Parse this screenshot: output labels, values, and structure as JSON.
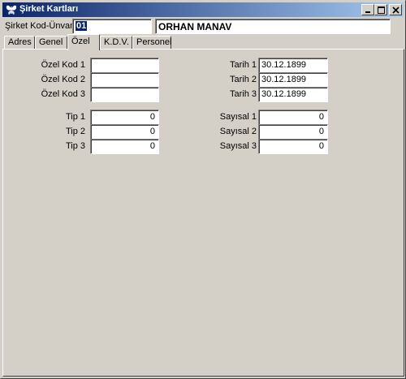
{
  "window": {
    "title": "Şirket Kartları",
    "buttons": {
      "minimize": "_",
      "maximize": "□",
      "close": "×"
    }
  },
  "header": {
    "code_label": "Şirket Kod-Ünvanı",
    "code_value": "01",
    "name_value": "ORHAN MANAV"
  },
  "tabs": [
    {
      "label": "Adres"
    },
    {
      "label": "Genel"
    },
    {
      "label": "Özel",
      "active": true
    },
    {
      "label": "K.D.V."
    },
    {
      "label": "Personel"
    }
  ],
  "ozel": {
    "special_codes": [
      {
        "label": "Özel Kod 1",
        "value": ""
      },
      {
        "label": "Özel Kod 2",
        "value": ""
      },
      {
        "label": "Özel Kod 3",
        "value": ""
      }
    ],
    "dates": [
      {
        "label": "Tarih 1",
        "value": "30.12.1899"
      },
      {
        "label": "Tarih 2",
        "value": "30.12.1899"
      },
      {
        "label": "Tarih 3",
        "value": "30.12.1899"
      }
    ],
    "types": [
      {
        "label": "Tip 1",
        "value": "0"
      },
      {
        "label": "Tip 2",
        "value": "0"
      },
      {
        "label": "Tip 3",
        "value": "0"
      }
    ],
    "numerics": [
      {
        "label": "Sayısal 1",
        "value": "0"
      },
      {
        "label": "Sayısal 2",
        "value": "0"
      },
      {
        "label": "Sayısal 3",
        "value": "0"
      }
    ]
  },
  "colors": {
    "titlebar_start": "#0a246a",
    "titlebar_end": "#a6caf0",
    "face": "#d4d0c8",
    "selection": "#0a246a"
  }
}
